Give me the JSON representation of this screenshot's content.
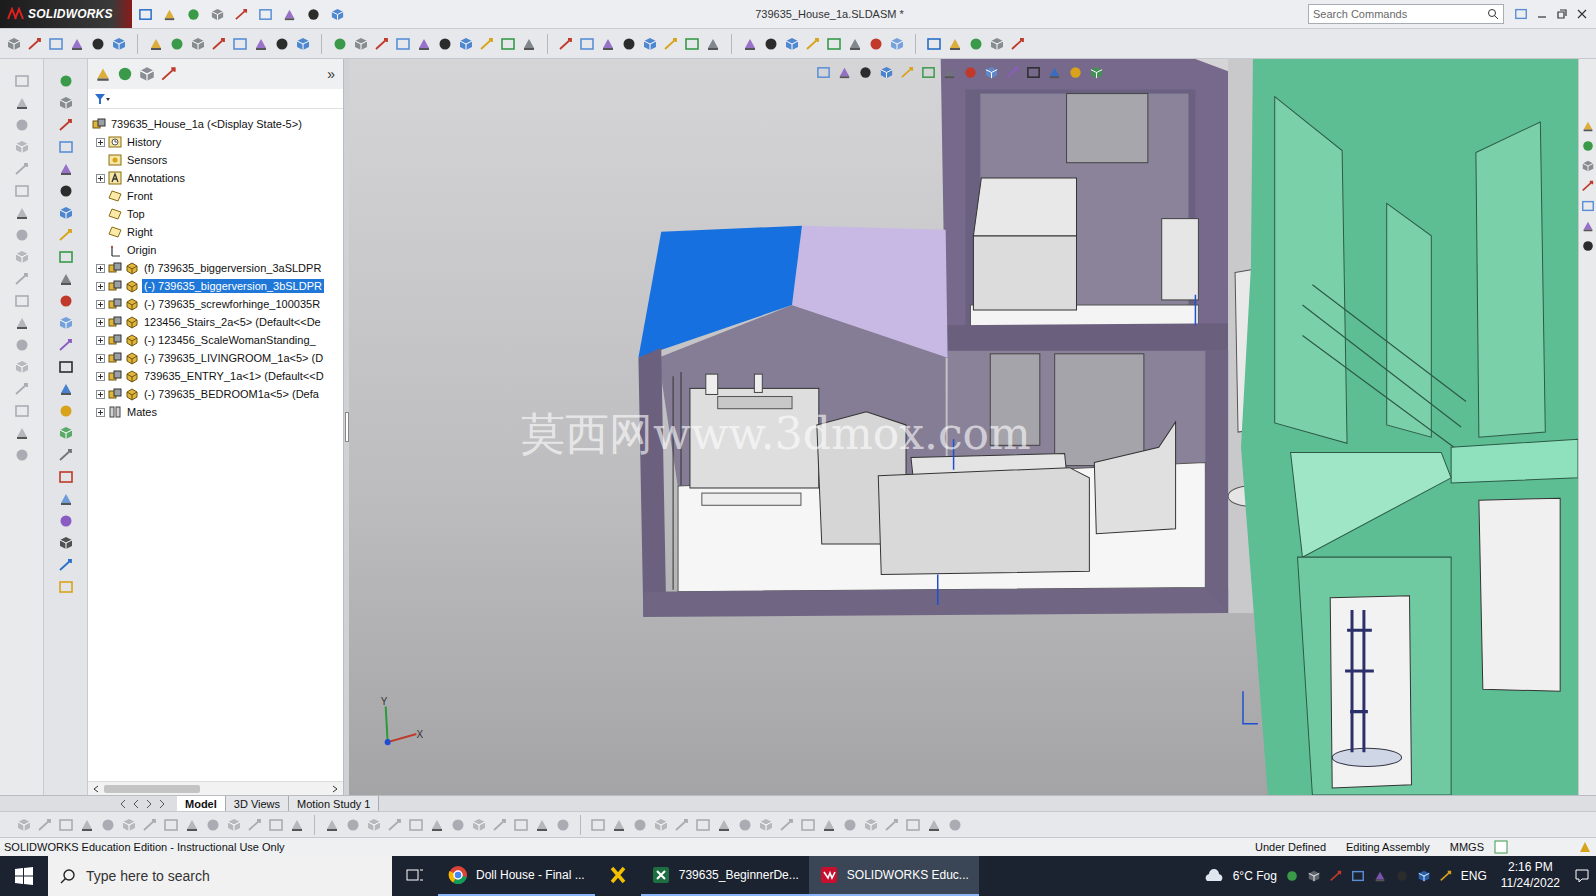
{
  "app": {
    "logo": "SOLIDWORKS",
    "title": "739635_House_1a.SLDASM *",
    "search_placeholder": "Search Commands"
  },
  "tree": {
    "chevron": "»",
    "items": [
      {
        "label": "739635_House_1a  (<Display State-5>)",
        "kind": "root",
        "expandable": false,
        "selected": false
      },
      {
        "label": "History",
        "kind": "history",
        "expandable": true,
        "selected": false
      },
      {
        "label": "Sensors",
        "kind": "sensors",
        "expandable": false,
        "selected": false
      },
      {
        "label": "Annotations",
        "kind": "annotations",
        "expandable": true,
        "selected": false
      },
      {
        "label": "Front",
        "kind": "plane",
        "expandable": false,
        "selected": false
      },
      {
        "label": "Top",
        "kind": "plane",
        "expandable": false,
        "selected": false
      },
      {
        "label": "Right",
        "kind": "plane",
        "expandable": false,
        "selected": false
      },
      {
        "label": "Origin",
        "kind": "origin",
        "expandable": false,
        "selected": false
      },
      {
        "label": "(f) 739635_biggerversion_3aSLDPR",
        "kind": "component",
        "expandable": true,
        "selected": false
      },
      {
        "label": "(-) 739635_biggerversion_3bSLDPR",
        "kind": "component",
        "expandable": true,
        "selected": true
      },
      {
        "label": "(-) 739635_screwforhinge_100035R",
        "kind": "component",
        "expandable": true,
        "selected": false
      },
      {
        "label": "123456_Stairs_2a<5> (Default<<De",
        "kind": "component",
        "expandable": true,
        "selected": false
      },
      {
        "label": "(-) 123456_ScaleWomanStanding_",
        "kind": "component",
        "expandable": true,
        "selected": false
      },
      {
        "label": "(-) 739635_LIVINGROOM_1a<5> (D",
        "kind": "component",
        "expandable": true,
        "selected": false
      },
      {
        "label": "739635_ENTRY_1a<1> (Default<<D",
        "kind": "component",
        "expandable": true,
        "selected": false
      },
      {
        "label": "(-) 739635_BEDROOM1a<5> (Defa",
        "kind": "component",
        "expandable": true,
        "selected": false
      },
      {
        "label": "Mates",
        "kind": "mates",
        "expandable": true,
        "selected": false
      }
    ]
  },
  "viewport": {
    "watermark": "莫西网www.3dmox.com",
    "triad": {
      "x": "X",
      "y": "Y"
    }
  },
  "tabs": [
    {
      "label": "Model",
      "selected": true
    },
    {
      "label": "3D Views",
      "selected": false
    },
    {
      "label": "Motion Study 1",
      "selected": false
    }
  ],
  "status_bar": {
    "left": "SOLIDWORKS Education Edition - Instructional Use Only",
    "items": [
      "Under Defined",
      "Editing Assembly",
      "MMGS"
    ]
  },
  "taskbar": {
    "search_placeholder": "Type here to search",
    "apps": [
      {
        "kind": "chrome",
        "label": "Doll House - Final ...",
        "open": true,
        "active": false
      },
      {
        "kind": "xapp",
        "label": "",
        "open": false,
        "active": false
      },
      {
        "kind": "excel",
        "label": "739635_BeginnerDe...",
        "open": true,
        "active": false
      },
      {
        "kind": "solidworks",
        "label": "SOLIDWORKS Educ...",
        "open": true,
        "active": true
      }
    ],
    "weather": "6°C  Fog",
    "language": "ENG",
    "time": "2:16 PM",
    "date": "11/24/2022"
  }
}
